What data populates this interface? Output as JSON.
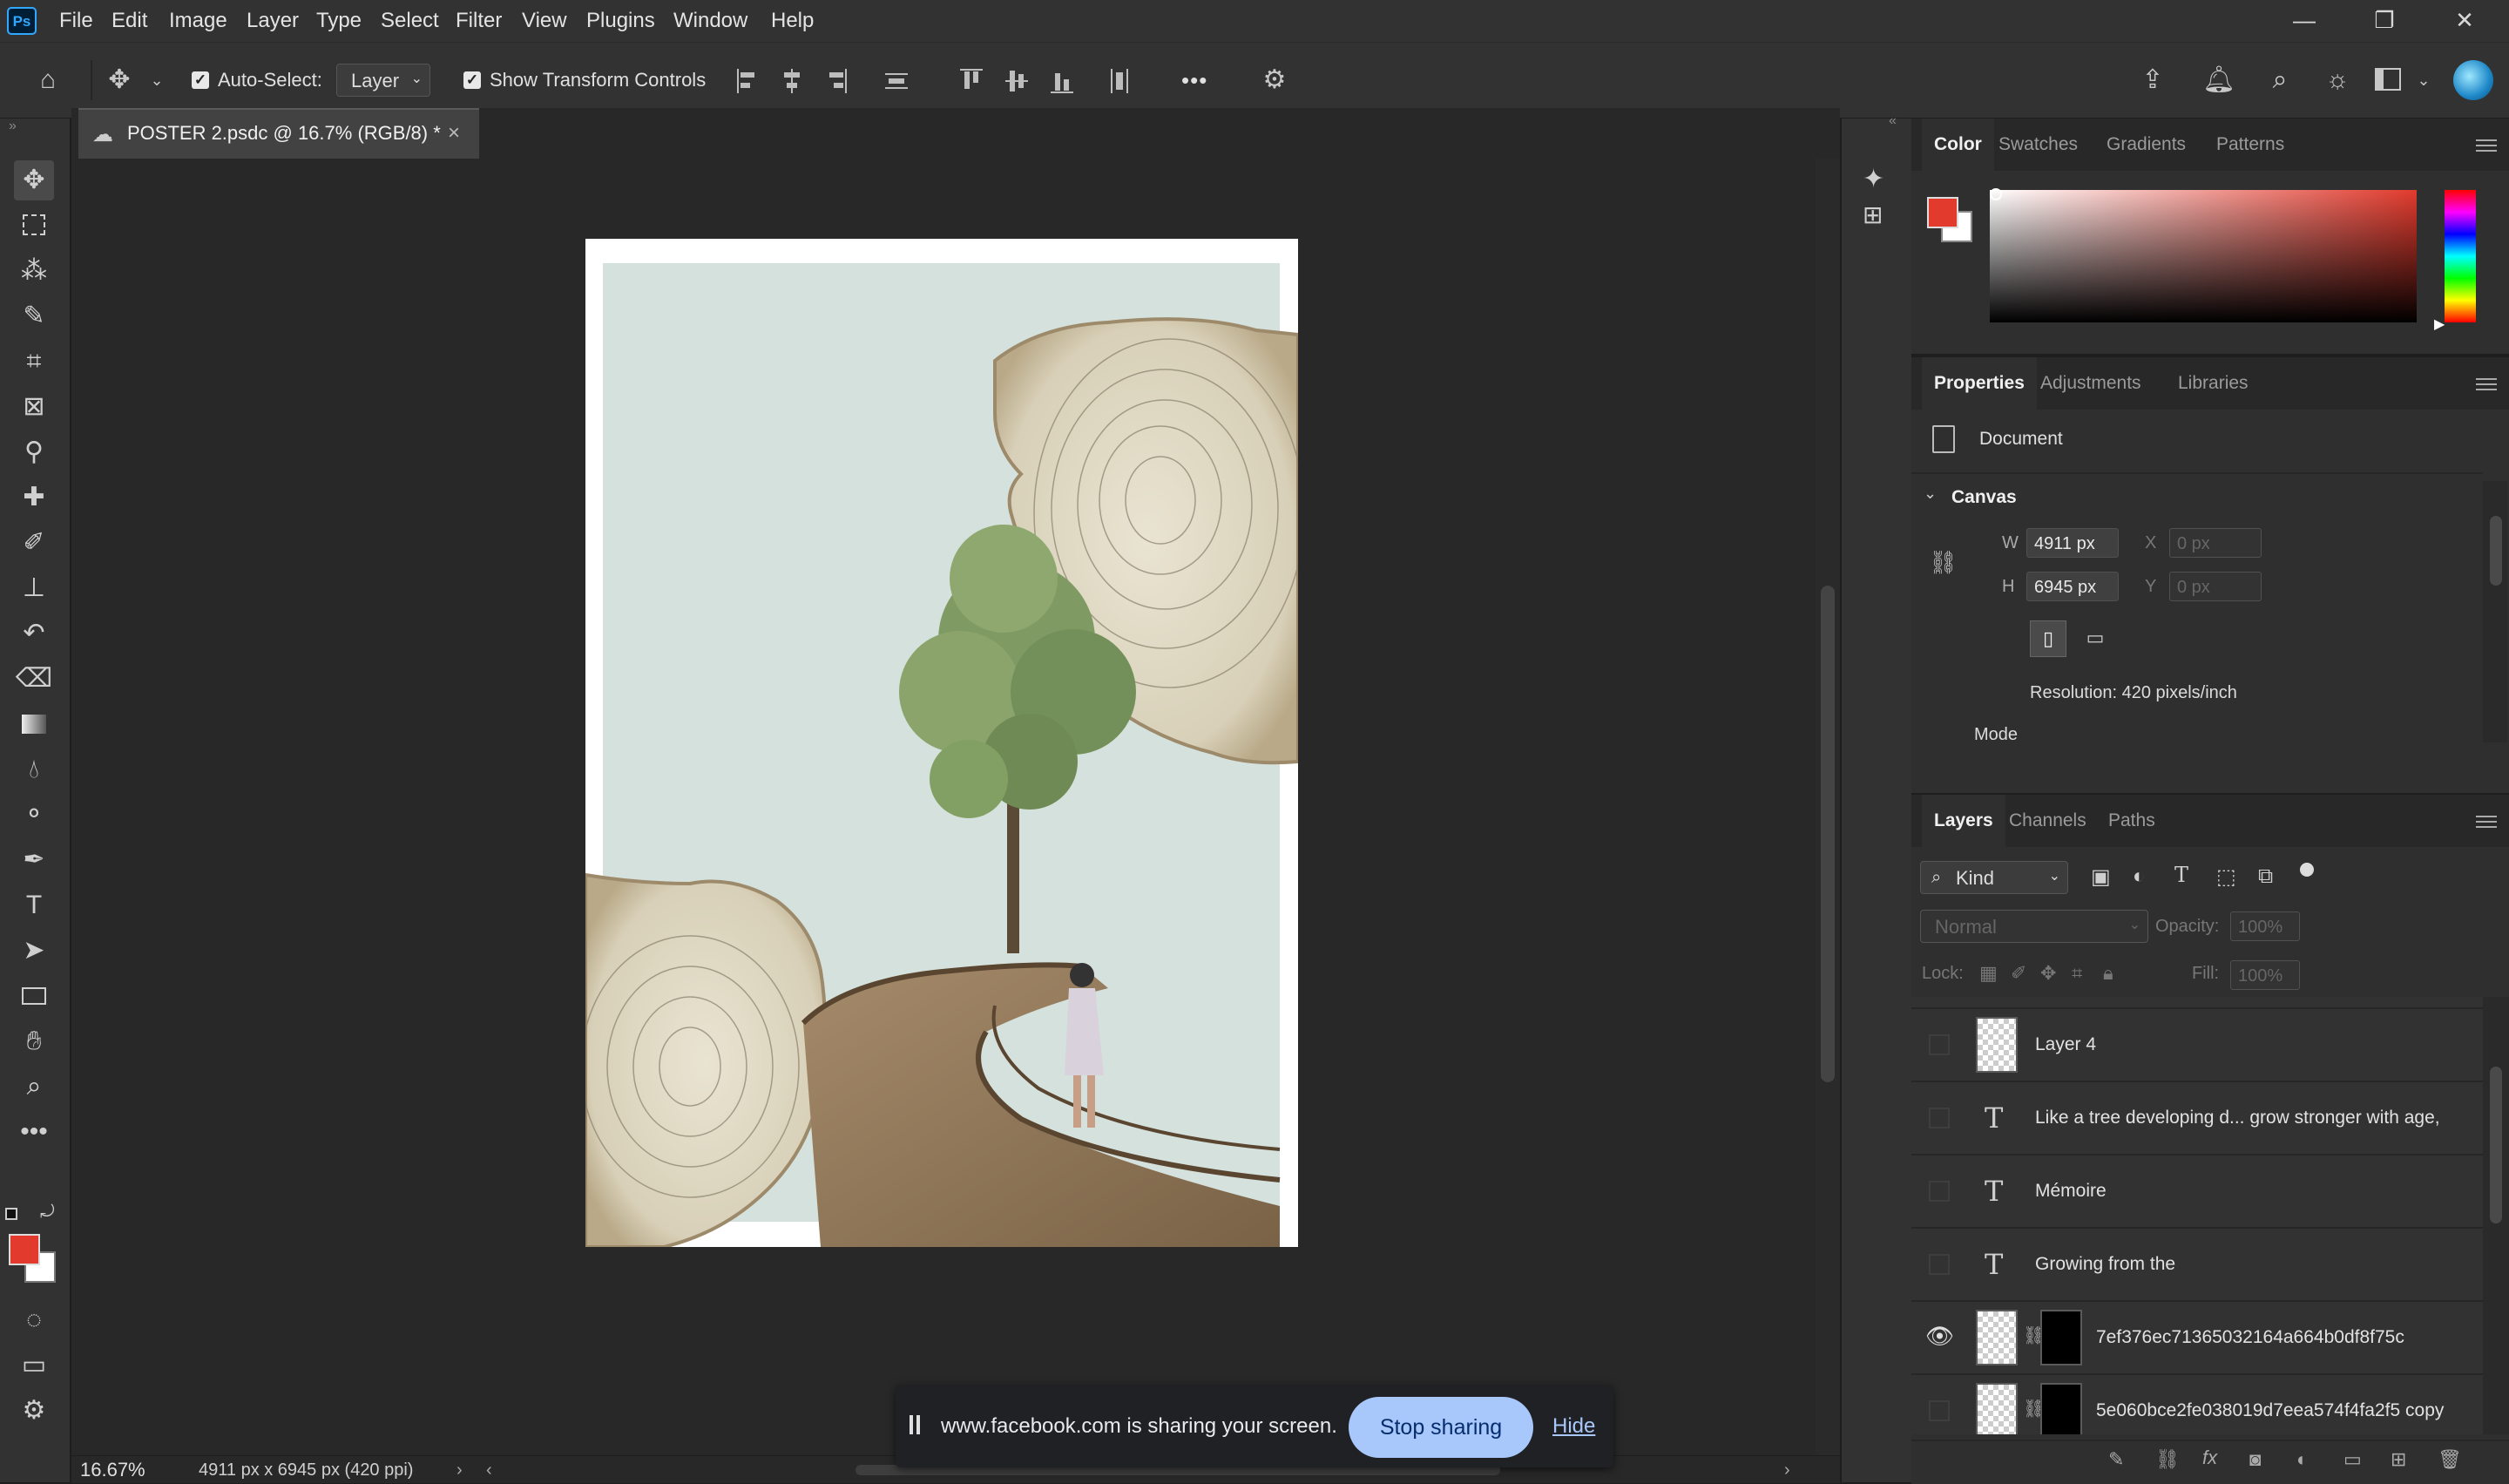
{
  "app": {
    "logo": "Ps"
  },
  "menu": [
    "File",
    "Edit",
    "Image",
    "Layer",
    "Type",
    "Select",
    "Filter",
    "View",
    "Plugins",
    "Window",
    "Help"
  ],
  "window_controls": {
    "minimize": "—",
    "maximize": "❐",
    "close": "✕"
  },
  "options_bar": {
    "auto_select_label": "Auto-Select:",
    "auto_select_checked": true,
    "auto_select_target": "Layer",
    "show_transform_label": "Show Transform Controls",
    "show_transform_checked": true,
    "more": "•••"
  },
  "document_tab": {
    "title": "POSTER 2.psdc @ 16.7% (RGB/8) *",
    "close": "×"
  },
  "status": {
    "zoom": "16.67%",
    "doc_info": "4911 px x 6945 px (420 ppi)"
  },
  "share_banner": {
    "message": "www.facebook.com is sharing your screen.",
    "stop_label": "Stop sharing",
    "hide_label": "Hide"
  },
  "color_panel": {
    "tabs": [
      "Color",
      "Swatches",
      "Gradients",
      "Patterns"
    ],
    "active_tab": "Color",
    "foreground": "#e23b2e",
    "background": "#ffffff"
  },
  "properties_panel": {
    "tabs": [
      "Properties",
      "Adjustments",
      "Libraries"
    ],
    "active_tab": "Properties",
    "type_label": "Document",
    "section": "Canvas",
    "w_label": "W",
    "w_value": "4911 px",
    "h_label": "H",
    "h_value": "6945 px",
    "x_label": "X",
    "x_value": "0 px",
    "y_label": "Y",
    "y_value": "0 px",
    "resolution": "Resolution: 420 pixels/inch",
    "mode_label": "Mode"
  },
  "layers_panel": {
    "tabs": [
      "Layers",
      "Channels",
      "Paths"
    ],
    "active_tab": "Layers",
    "filter_kind": "Kind",
    "blend_mode": "Normal",
    "opacity_label": "Opacity:",
    "opacity_value": "100%",
    "lock_label": "Lock:",
    "fill_label": "Fill:",
    "fill_value": "100%",
    "layers": [
      {
        "name": "Layer 4",
        "kind": "pixel",
        "visible": false
      },
      {
        "name": "Like a tree developing d... grow stronger with age,",
        "kind": "text",
        "visible": false
      },
      {
        "name": "Mémoire",
        "kind": "text",
        "visible": false
      },
      {
        "name": "Growing from the",
        "kind": "text",
        "visible": false
      },
      {
        "name": "7ef376ec71365032164a664b0df8f75c",
        "kind": "smart-masked",
        "visible": true
      },
      {
        "name": "5e060bce2fe038019d7eea574f4fa2f5 copy",
        "kind": "smart-masked",
        "visible": false
      }
    ]
  },
  "colors": {
    "accent": "#31a8ff",
    "stop_button": "#a8c7fa",
    "swatch_fg": "#e23b2e"
  }
}
